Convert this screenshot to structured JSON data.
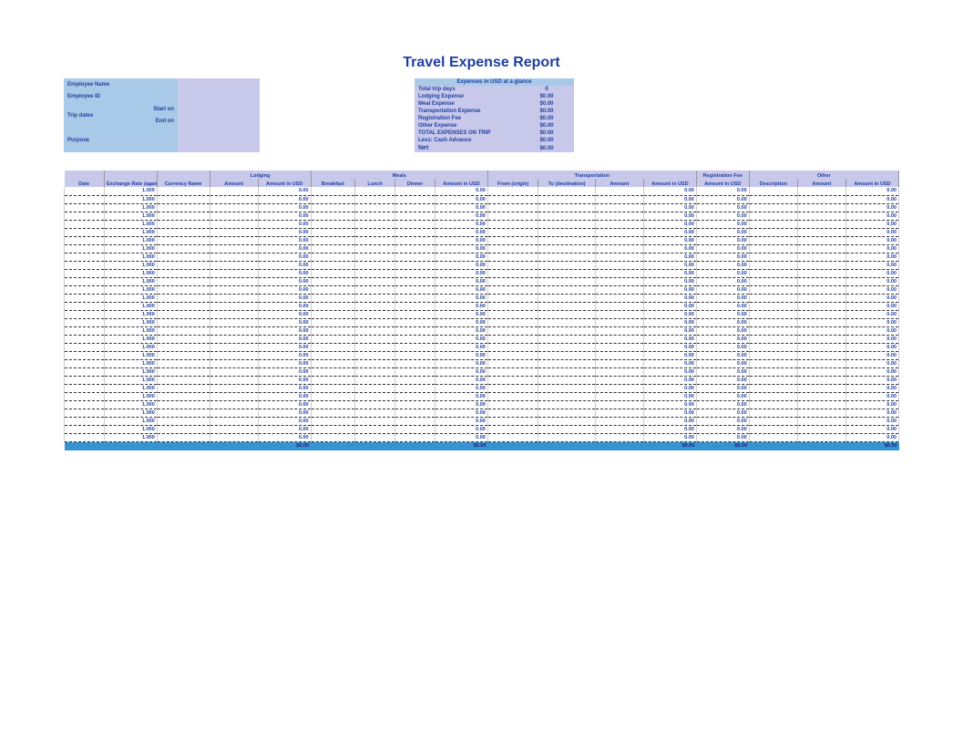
{
  "title": "Travel Expense Report",
  "info": {
    "employee_name_label": "Employee Name",
    "employee_id_label": "Employee ID",
    "trip_dates_label": "Trip dates",
    "start_on_label": "Start on",
    "end_on_label": "End on",
    "purpose_label": "Purpose",
    "employee_name": "",
    "employee_id": "",
    "start_on": "",
    "end_on": "",
    "purpose": ""
  },
  "summary": {
    "header": "Expenses in USD at a glance",
    "rows": [
      {
        "label": "Total trip days",
        "value": "0"
      },
      {
        "label": "Lodging Expense",
        "value": "$0.00"
      },
      {
        "label": "Meal Expense",
        "value": "$0.00"
      },
      {
        "label": "Transportation Expense",
        "value": "$0.00"
      },
      {
        "label": "Registration Fee",
        "value": "$0.00"
      },
      {
        "label": "Other Expense",
        "value": "$0.00"
      },
      {
        "label": "TOTAL EXPENSES ON TRIP",
        "value": "$0.00"
      },
      {
        "label": "Less: Cash Advance",
        "value": "$0.00"
      },
      {
        "label": "Net",
        "value": "$0.00"
      }
    ]
  },
  "columns": {
    "groups": {
      "lodging": "Lodging",
      "meals": "Meals",
      "transportation": "Transportation",
      "registration": "Registration Fee",
      "other": "Other"
    },
    "headers": {
      "date": "Date",
      "exchange_rate": "Exchange Rate (against dollar)",
      "currency_name": "Currency Name",
      "amount": "Amount",
      "amount_usd": "Amount in USD",
      "breakfast": "Breakfast",
      "lunch": "Lunch",
      "dinner": "Dinner",
      "from": "From (origin)",
      "to": "To (destination)",
      "description": "Description"
    }
  },
  "row_defaults": {
    "exchange_rate": "1.000",
    "amount_usd": "0.00"
  },
  "row_count": 31,
  "totals": {
    "amount_usd": "$0.00"
  }
}
